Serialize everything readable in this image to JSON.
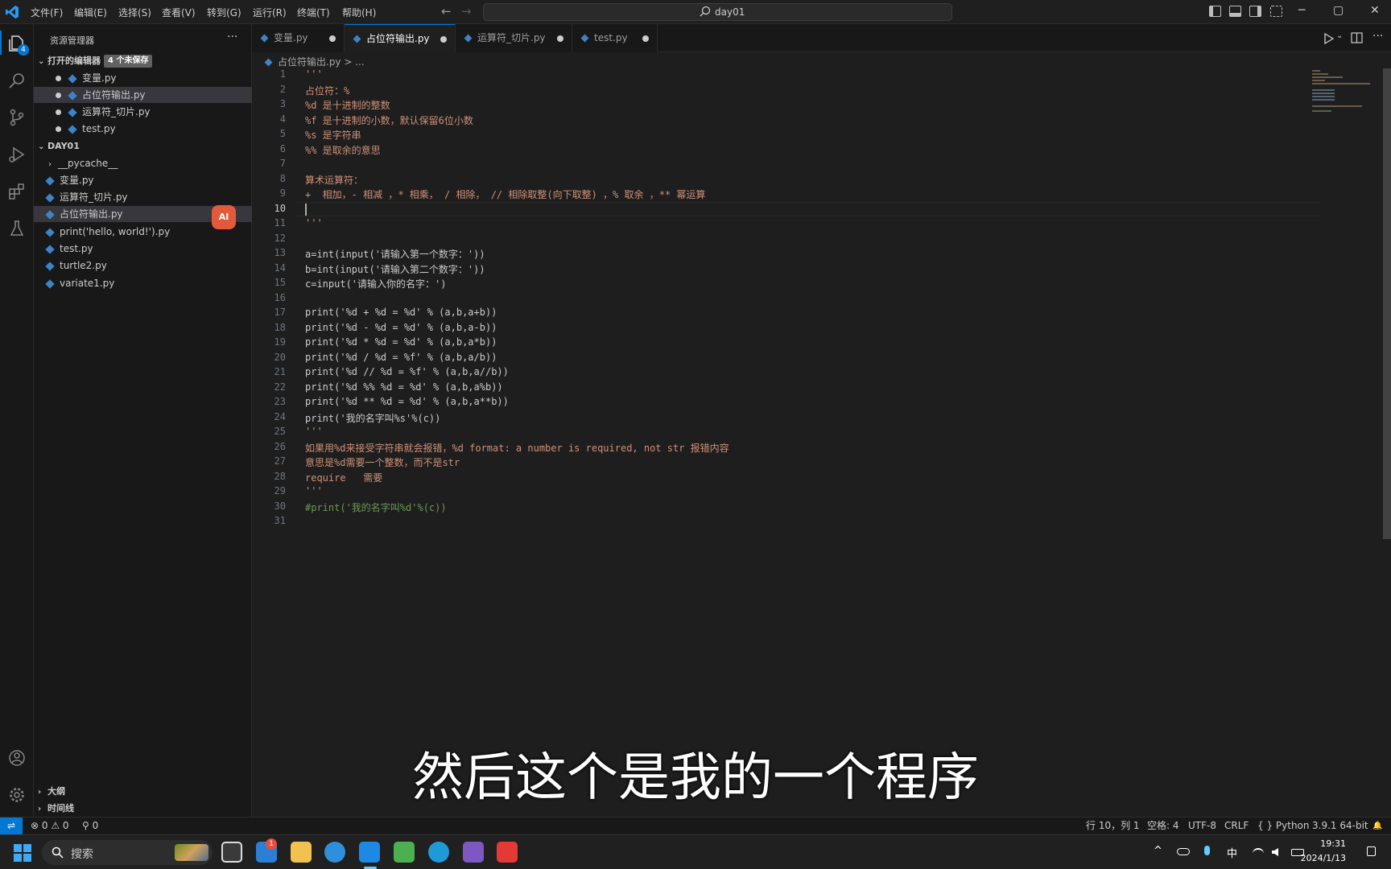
{
  "titlebar": {
    "menus": [
      "文件(F)",
      "编辑(E)",
      "选择(S)",
      "查看(V)",
      "转到(G)",
      "运行(R)",
      "终端(T)",
      "帮助(H)"
    ],
    "search_text": "day01",
    "back_arrow": "←",
    "forward_arrow": "→",
    "minimize": "─",
    "restore": "▢",
    "close": "✕"
  },
  "activity": {
    "explorer_badge": "4"
  },
  "sidebar": {
    "title": "资源管理器",
    "more": "···",
    "open_editors_label": "打开的编辑器",
    "unsaved_badge": "4 个未保存",
    "open_editors": [
      "变量.py",
      "占位符输出.py",
      "运算符_切片.py",
      "test.py"
    ],
    "folder_name": "DAY01",
    "files": [
      "__pycache__",
      "变量.py",
      "运算符_切片.py",
      "占位符输出.py",
      "print('hello, world!').py",
      "test.py",
      "turtle2.py",
      "variate1.py"
    ],
    "ai_badge": "AI",
    "outline_label": "大纲",
    "timeline_label": "时间线"
  },
  "tabs": [
    {
      "label": "变量.py"
    },
    {
      "label": "占位符输出.py"
    },
    {
      "label": "运算符_切片.py"
    },
    {
      "label": "test.py"
    }
  ],
  "breadcrumb": "占位符输出.py > ...",
  "editor": {
    "current_line": "10",
    "lines": [
      "'''",
      "占位符：%",
      "%d 是十进制的整数",
      "%f 是十进制的小数，默认保留6位小数",
      "%s 是字符串",
      "%% 是取余的意思",
      "",
      "算术运算符：",
      "+  相加，- 相减 ，* 相乘， / 相除， // 相除取整(向下取整) ，% 取余 ，** 幂运算",
      "",
      "'''",
      "",
      "a=int(input('请输入第一个数字：'))",
      "b=int(input('请输入第二个数字：'))",
      "c=input('请输入你的名字：')",
      "",
      "print('%d + %d = %d' % (a,b,a+b))",
      "print('%d - %d = %d' % (a,b,a-b))",
      "print('%d * %d = %d' % (a,b,a*b))",
      "print('%d / %d = %f' % (a,b,a/b))",
      "print('%d // %d = %f' % (a,b,a//b))",
      "print('%d %% %d = %d' % (a,b,a%b))",
      "print('%d ** %d = %d' % (a,b,a**b))",
      "print('我的名字叫%s'%(c))",
      "'''",
      "如果用%d来接受字符串就会报错，%d format: a number is required, not str 报错内容",
      "意思是%d需要一个整数，而不是str",
      "require   需要",
      "'''",
      "#print('我的名字叫%d'%(c))",
      ""
    ]
  },
  "subtitle": "然后这个是我的一个程序",
  "statusbar": {
    "remote": "⇌",
    "problems": "⊗ 0 ⚠ 0",
    "ports": "⚲ 0",
    "position": "行 10，列 1",
    "spaces": "空格: 4",
    "encoding": "UTF-8",
    "eol": "CRLF",
    "language": "{ } Python",
    "interpreter": "3.9.1 64-bit",
    "bell": "🔔"
  },
  "taskbar": {
    "search_placeholder": "搜索",
    "ime": "中",
    "time": "19:31",
    "date": "2024/1/13",
    "notification_badge": "1"
  }
}
